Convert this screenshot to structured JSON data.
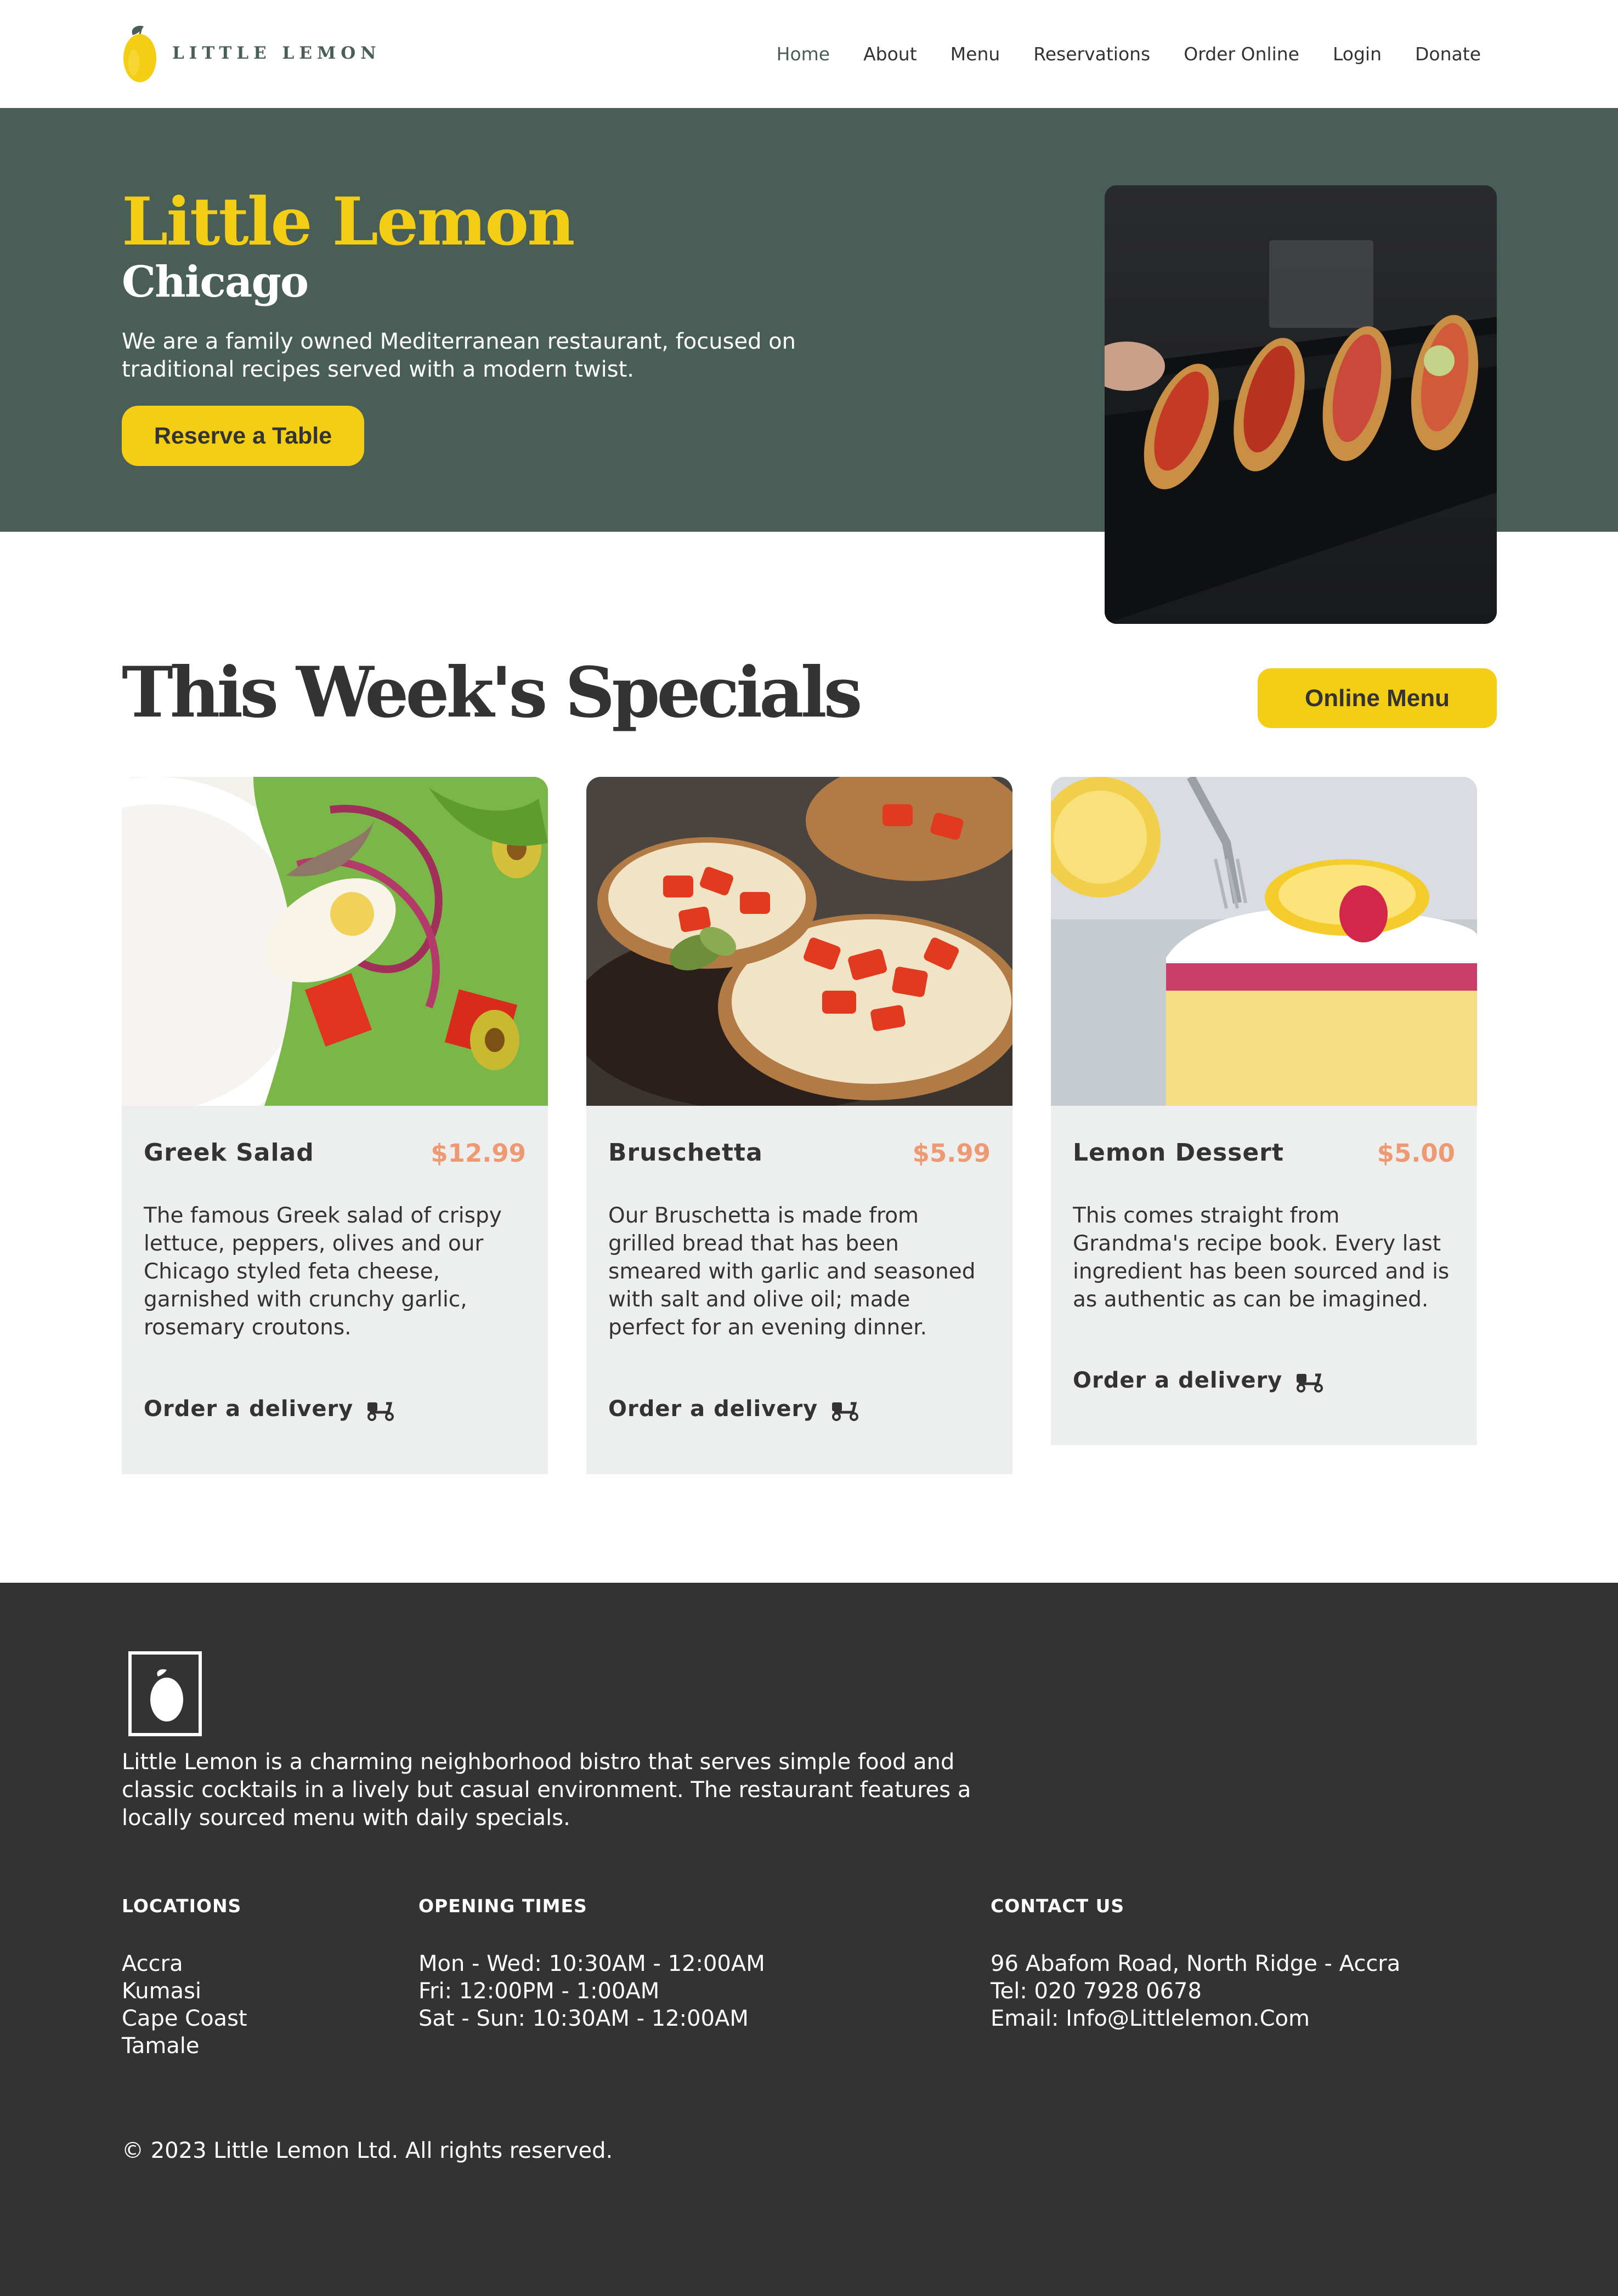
{
  "nav": {
    "brand": "LITTLE LEMON",
    "links": [
      "Home",
      "About",
      "Menu",
      "Reservations",
      "Order Online",
      "Login",
      "Donate"
    ],
    "active": "Home"
  },
  "hero": {
    "title": "Little Lemon",
    "subtitle": "Chicago",
    "description": "We are a family owned Mediterranean restaurant, focused on traditional recipes served with a modern twist.",
    "button": "Reserve a Table"
  },
  "specials": {
    "title": "This Week's Specials",
    "button": "Online Menu",
    "cards": [
      {
        "name": "Greek Salad",
        "price": "$12.99",
        "description": "The famous Greek salad of crispy lettuce, peppers, olives and our Chicago styled feta cheese, garnished with crunchy garlic, rosemary croutons.",
        "order": "Order a delivery"
      },
      {
        "name": "Bruschetta",
        "price": "$5.99",
        "description": "Our Bruschetta is made from grilled bread that has been smeared with garlic and seasoned with salt and olive oil; made perfect for an evening dinner.",
        "order": "Order a delivery"
      },
      {
        "name": "Lemon Dessert",
        "price": "$5.00",
        "description": "This comes straight from Grandma's recipe book. Every last ingredient has been sourced and is as authentic as can be imagined.",
        "order": "Order a delivery"
      }
    ]
  },
  "footer": {
    "about": "Little Lemon is a charming neighborhood bistro that serves simple food and classic cocktails in a lively but casual environment. The restaurant features a locally sourced menu with daily specials.",
    "locations": {
      "heading": "LOCATIONS",
      "items": [
        "Accra",
        "Kumasi",
        "Cape Coast",
        "Tamale"
      ]
    },
    "opening": {
      "heading": "OPENING TIMES",
      "items": [
        "Mon - Wed: 10:30AM - 12:00AM",
        "Fri: 12:00PM - 1:00AM",
        "Sat - Sun: 10:30AM - 12:00AM"
      ]
    },
    "contact": {
      "heading": "CONTACT US",
      "items": [
        "96 Abafom Road, North Ridge - Accra",
        "Tel: 020 7928 0678",
        "Email: Info@Littlelemon.Com"
      ]
    },
    "copyright": "© 2023 Little Lemon Ltd. All rights reserved."
  },
  "colors": {
    "primary_green": "#495e57",
    "primary_yellow": "#f4ce14",
    "accent_salmon": "#ee9972",
    "card_bg": "#edefee",
    "footer_bg": "#333333"
  }
}
